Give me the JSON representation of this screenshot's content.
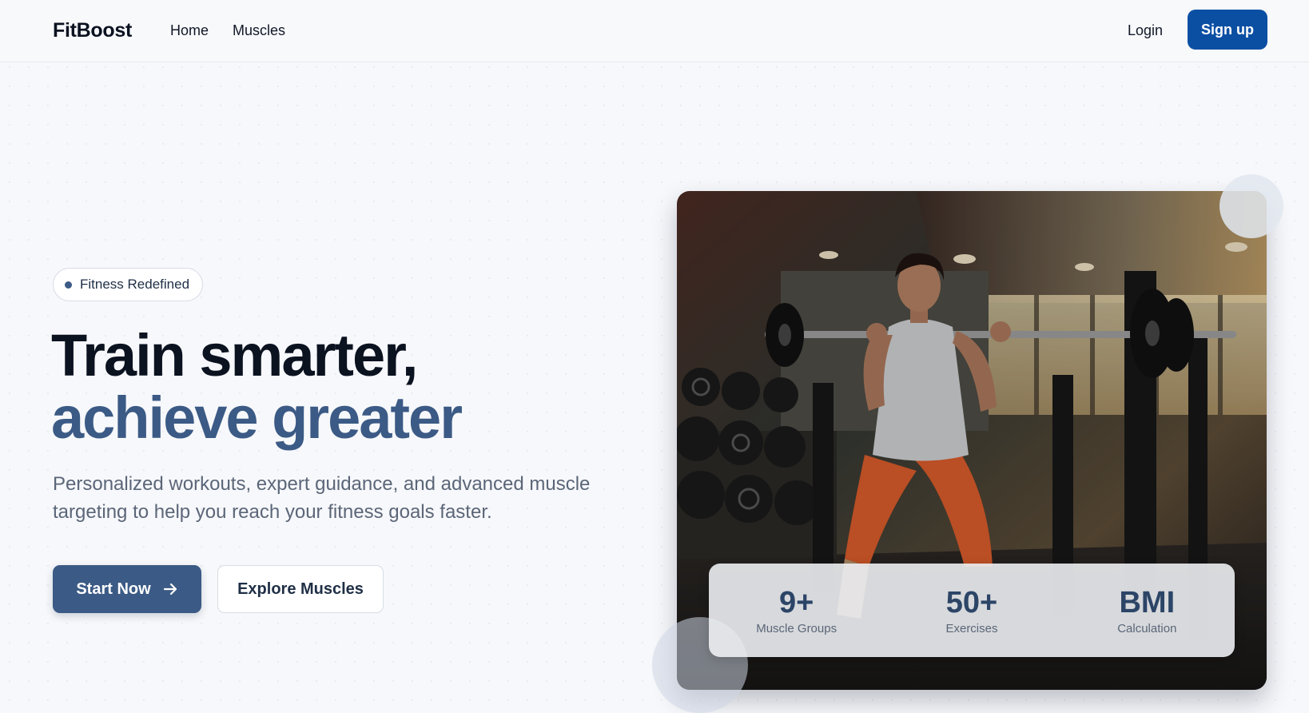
{
  "navbar": {
    "brand": "FitBoost",
    "links": [
      "Home",
      "Muscles"
    ],
    "login": "Login",
    "signup": "Sign up",
    "signup_color": "#0b4fa3"
  },
  "hero": {
    "badge": "Fitness Redefined",
    "headline_line1": "Train smarter,",
    "headline_line2": "achieve greater",
    "subtext": "Personalized workouts, expert guidance, and advanced muscle targeting to help you reach your fitness goals faster.",
    "primary_cta": "Start Now",
    "secondary_cta": "Explore Muscles",
    "accent_color": "#3b5a85",
    "image_icon": "gym-photo-woman-squat-barbell"
  },
  "stats": [
    {
      "value": "9+",
      "label": "Muscle Groups"
    },
    {
      "value": "50+",
      "label": "Exercises"
    },
    {
      "value": "BMI",
      "label": "Calculation"
    }
  ]
}
